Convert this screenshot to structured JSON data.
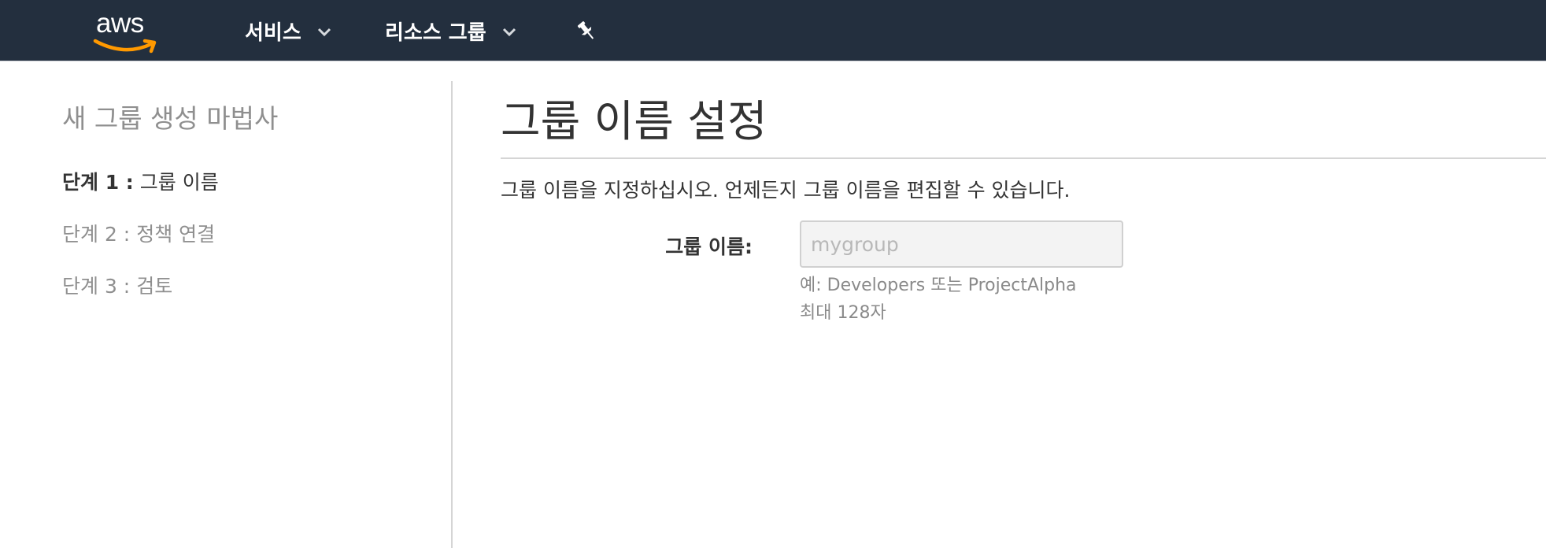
{
  "topnav": {
    "logo_text": "aws",
    "services_label": "서비스",
    "resource_groups_label": "리소스 그룹",
    "pin_icon": "pushpin-icon",
    "background_color": "#232f3e",
    "logo_accent_color": "#ff9900"
  },
  "sidebar": {
    "wizard_title": "새 그룹 생성 마법사",
    "steps": [
      {
        "prefix": "단계 1 :",
        "label": "그룹 이름",
        "active": true
      },
      {
        "prefix": "단계 2 :",
        "label": "정책 연결",
        "active": false
      },
      {
        "prefix": "단계 3 :",
        "label": "검토",
        "active": false
      }
    ]
  },
  "main": {
    "title": "그룹 이름 설정",
    "description": "그룹 이름을 지정하십시오. 언제든지 그룹 이름을 편집할 수 있습니다.",
    "group_name_field": {
      "label": "그룹 이름:",
      "value": "",
      "placeholder": "mygroup",
      "hint_example": "예: Developers 또는 ProjectAlpha",
      "hint_max": "최대 128자"
    }
  }
}
